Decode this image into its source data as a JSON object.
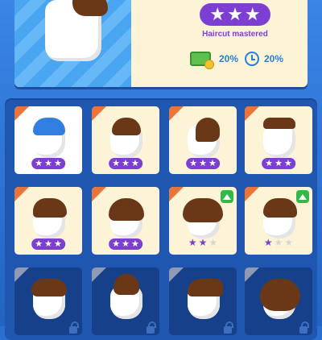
{
  "header": {
    "stars": [
      true,
      true,
      true
    ],
    "caption": "Haircut mastered",
    "money_icon": "cash-coin-icon",
    "money_bonus": "20%",
    "time_icon": "clock-icon",
    "time_bonus": "20%"
  },
  "grid": {
    "cards": [
      {
        "state": "selected",
        "rating": 3,
        "style": "blue-quiff"
      },
      {
        "state": "unlocked",
        "rating": 3,
        "style": "brown-short"
      },
      {
        "state": "unlocked",
        "rating": 3,
        "style": "brown-side"
      },
      {
        "state": "unlocked",
        "rating": 3,
        "style": "brown-flat"
      },
      {
        "state": "unlocked",
        "rating": 3,
        "style": "brown-wave"
      },
      {
        "state": "unlocked",
        "rating": 3,
        "style": "brown-spiky"
      },
      {
        "state": "upgradable",
        "rating": 2,
        "style": "brown-curly"
      },
      {
        "state": "upgradable",
        "rating": 1,
        "style": "brown-parted"
      },
      {
        "state": "locked",
        "style": "brown-mop"
      },
      {
        "state": "locked",
        "style": "brown-bun"
      },
      {
        "state": "locked",
        "style": "brown-swoop"
      },
      {
        "state": "locked",
        "style": "brown-long"
      }
    ]
  },
  "colors": {
    "accent_purple": "#7c3fd1",
    "cream": "#fdf3d6",
    "hair_brown": "#6a3816",
    "selected_hair": "#2f7ee0",
    "upgrade_green": "#33b84a"
  }
}
